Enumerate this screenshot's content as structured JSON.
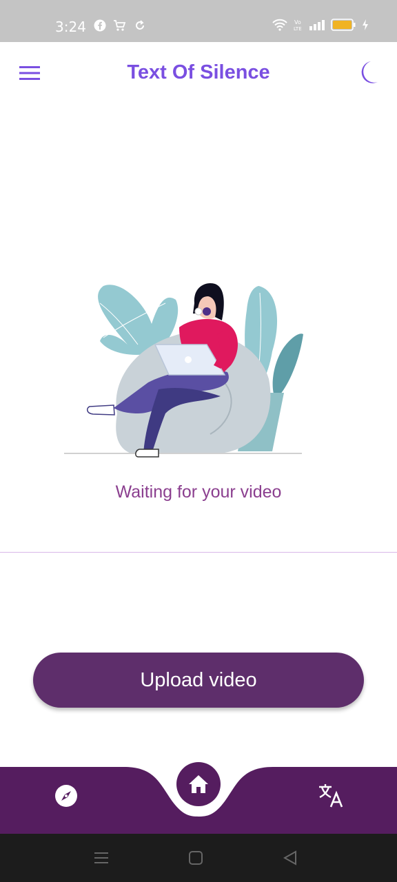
{
  "status_bar": {
    "time": "3:24",
    "left_icons": [
      "facebook-icon",
      "cart-icon",
      "sync-icon"
    ],
    "right_icons": [
      "wifi-icon",
      "volte-icon",
      "signal-icon",
      "battery-icon",
      "charging-icon"
    ],
    "battery_color": "#f0b323"
  },
  "app_bar": {
    "title": "Text Of Silence",
    "accent_color": "#7a4fe1"
  },
  "main": {
    "status_text": "Waiting for your video",
    "upload_label": "Upload video",
    "button_color": "#5e2e6b"
  },
  "bottom_nav": {
    "bar_color": "#551d5f",
    "items": [
      "compass-icon",
      "home-icon",
      "translate-icon"
    ]
  },
  "system_nav": {
    "buttons": [
      "recent-apps-icon",
      "home-square-icon",
      "back-triangle-icon"
    ]
  }
}
